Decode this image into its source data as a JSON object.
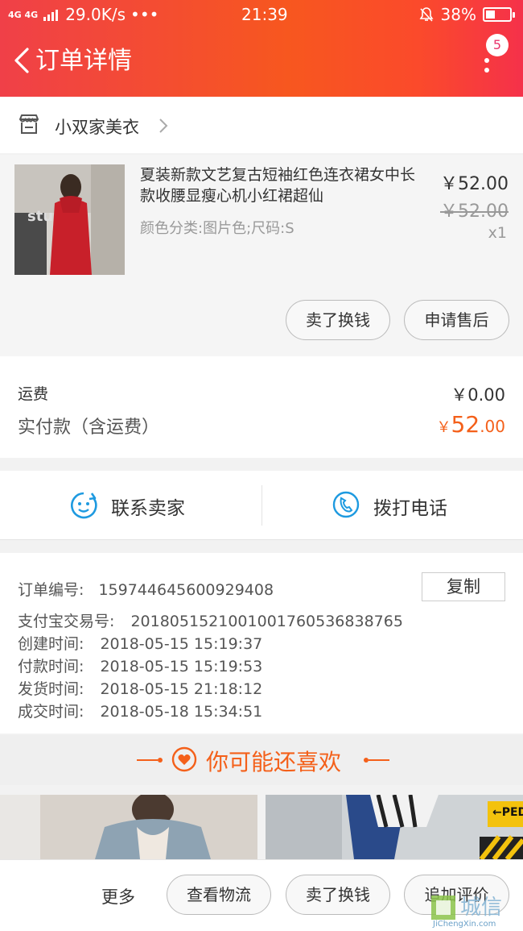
{
  "status_bar": {
    "network": "4G 4G",
    "speed": "29.0K/s",
    "dots": "•••",
    "time": "21:39",
    "battery": "38%",
    "battery_level": 0.38
  },
  "header": {
    "title": "订单详情",
    "badge_count": "5"
  },
  "shop": {
    "name": "小双家美衣"
  },
  "item": {
    "title": "夏装新款文艺复古短袖红色连衣裙女中长款收腰显瘦心机小红裙超仙",
    "spec": "颜色分类:图片色;尺码:S",
    "price": "￥52.00",
    "old_price": "￥52.00",
    "qty": "x1",
    "thumb_text": "stu",
    "btn_sell": "卖了换钱",
    "btn_after_sale": "申请售后"
  },
  "fees": {
    "shipping_label": "运费",
    "shipping_value": "￥0.00",
    "paid_label": "实付款（含运费）",
    "paid_currency": "￥",
    "paid_int": "52",
    "paid_dec": ".00",
    "accent": "#f4601a"
  },
  "contact": {
    "seller": "联系卖家",
    "call": "拨打电话"
  },
  "order_info": {
    "order_no_label": "订单编号:",
    "order_no": "159744645600929408",
    "copy": "复制",
    "alipay_label": "支付宝交易号:",
    "alipay_no": "2018051521001001760536838765",
    "created_label": "创建时间:",
    "created": "2018-05-15 15:19:37",
    "paid_label": "付款时间:",
    "paid": "2018-05-15 15:19:53",
    "shipped_label": "发货时间:",
    "shipped": "2018-05-15 21:18:12",
    "done_label": "成交时间:",
    "done": "2018-05-18 15:34:51"
  },
  "recommend": {
    "title": "你可能还喜欢"
  },
  "bottom_bar": {
    "more": "更多",
    "logistics": "查看物流",
    "sell": "卖了换钱",
    "review": "追加评价"
  },
  "watermark": {
    "text": "JiChengXin.com",
    "logo_text": "城信"
  }
}
